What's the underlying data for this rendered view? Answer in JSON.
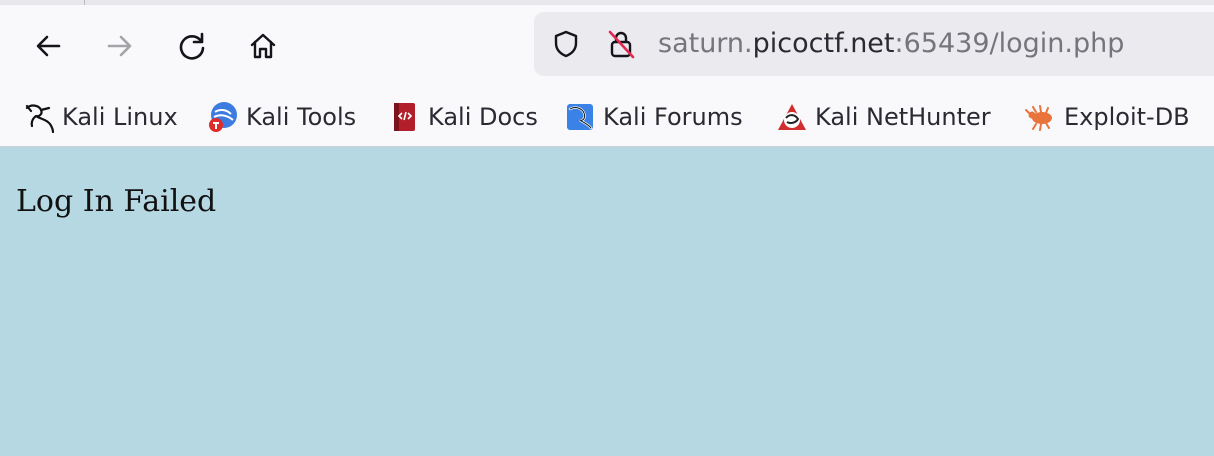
{
  "browser": {
    "nav": {
      "back": "back-arrow-icon",
      "forward": "forward-arrow-icon",
      "reload": "reload-icon",
      "home": "home-icon"
    },
    "url": {
      "prefix": "saturn.",
      "host": "picoctf.net",
      "suffix": ":65439/login.php",
      "security_icons": [
        "shield-icon",
        "insecure-lock-icon"
      ]
    },
    "bookmarks": [
      {
        "label": "Kali Linux",
        "icon": "kali-dragon-icon"
      },
      {
        "label": "Kali Tools",
        "icon": "kali-tools-icon"
      },
      {
        "label": "Kali Docs",
        "icon": "kali-docs-icon"
      },
      {
        "label": "Kali Forums",
        "icon": "kali-forums-icon"
      },
      {
        "label": "Kali NetHunter",
        "icon": "kali-nethunter-icon"
      },
      {
        "label": "Exploit-DB",
        "icon": "exploit-db-icon"
      }
    ]
  },
  "page": {
    "message": "Log In Failed",
    "background": "#b6d8e3"
  }
}
